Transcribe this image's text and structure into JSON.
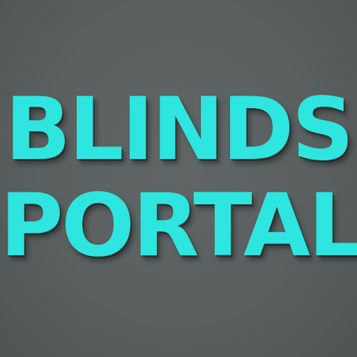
{
  "logo": {
    "line1": "BLINDS",
    "line2": "PORTAL"
  },
  "colors": {
    "background": "#5b6060",
    "text": "#2ee5df"
  }
}
